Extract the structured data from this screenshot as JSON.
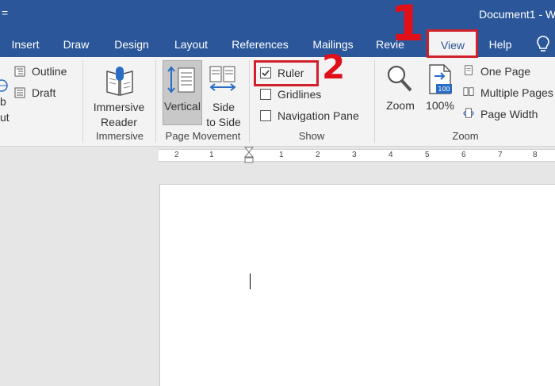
{
  "title_bar": {
    "quick_access": "=",
    "document_title": "Document1 - W"
  },
  "tabs": [
    {
      "label": "Insert"
    },
    {
      "label": "Draw"
    },
    {
      "label": "Design"
    },
    {
      "label": "Layout"
    },
    {
      "label": "References"
    },
    {
      "label": "Mailings"
    },
    {
      "label": "Revie"
    },
    {
      "label": "View"
    },
    {
      "label": "Help"
    }
  ],
  "views_group": {
    "outline": "Outline",
    "draft": "Draft",
    "web_layout_partial_1": "b",
    "web_layout_partial_2": "ut"
  },
  "immersive_group": {
    "reader_line1": "Immersive",
    "reader_line2": "Reader",
    "label": "Immersive"
  },
  "page_movement_group": {
    "vertical": "Vertical",
    "side_line1": "Side",
    "side_line2": "to Side",
    "label": "Page Movement"
  },
  "show_group": {
    "ruler": "Ruler",
    "gridlines": "Gridlines",
    "navigation_pane": "Navigation Pane",
    "label": "Show",
    "ruler_checked": true
  },
  "zoom_group": {
    "zoom": "Zoom",
    "percent": "100%",
    "one_page": "One Page",
    "multiple_pages": "Multiple Pages",
    "page_width": "Page Width",
    "label": "Zoom",
    "percent_badge": "100"
  },
  "ruler_numbers": [
    "2",
    "1",
    "1",
    "2",
    "3",
    "4",
    "5",
    "6",
    "7",
    "8"
  ],
  "annotations": {
    "step1": "1",
    "step2": "2"
  },
  "colors": {
    "title_bar": "#2b579a",
    "ribbon": "#f3f3f3",
    "annotation": "#d0202a"
  }
}
